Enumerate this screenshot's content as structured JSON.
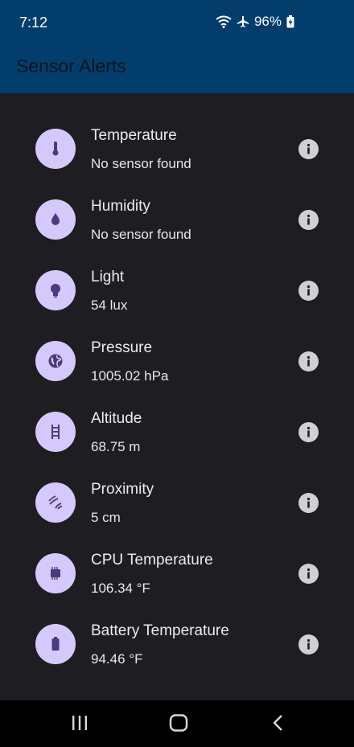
{
  "status": {
    "time": "7:12",
    "battery": "96%"
  },
  "appbar": {
    "title": "Sensor Alerts"
  },
  "sensors": [
    {
      "title": "Temperature",
      "value": "No sensor found",
      "icon": "thermometer-icon"
    },
    {
      "title": "Humidity",
      "value": "No sensor found",
      "icon": "water-drop-icon"
    },
    {
      "title": "Light",
      "value": "54 lux",
      "icon": "lightbulb-icon"
    },
    {
      "title": "Pressure",
      "value": "1005.02 hPa",
      "icon": "globe-icon"
    },
    {
      "title": "Altitude",
      "value": "68.75 m",
      "icon": "ladder-icon"
    },
    {
      "title": "Proximity",
      "value": "5 cm",
      "icon": "proximity-icon"
    },
    {
      "title": "CPU Temperature",
      "value": "106.34 °F",
      "icon": "chip-icon"
    },
    {
      "title": "Battery Temperature",
      "value": "94.46 °F",
      "icon": "battery-icon"
    }
  ],
  "colors": {
    "bar": "#033d6b",
    "background": "#1e1e22",
    "icon_circle": "#d5c9fb",
    "icon_fg": "#4b3a7c"
  }
}
